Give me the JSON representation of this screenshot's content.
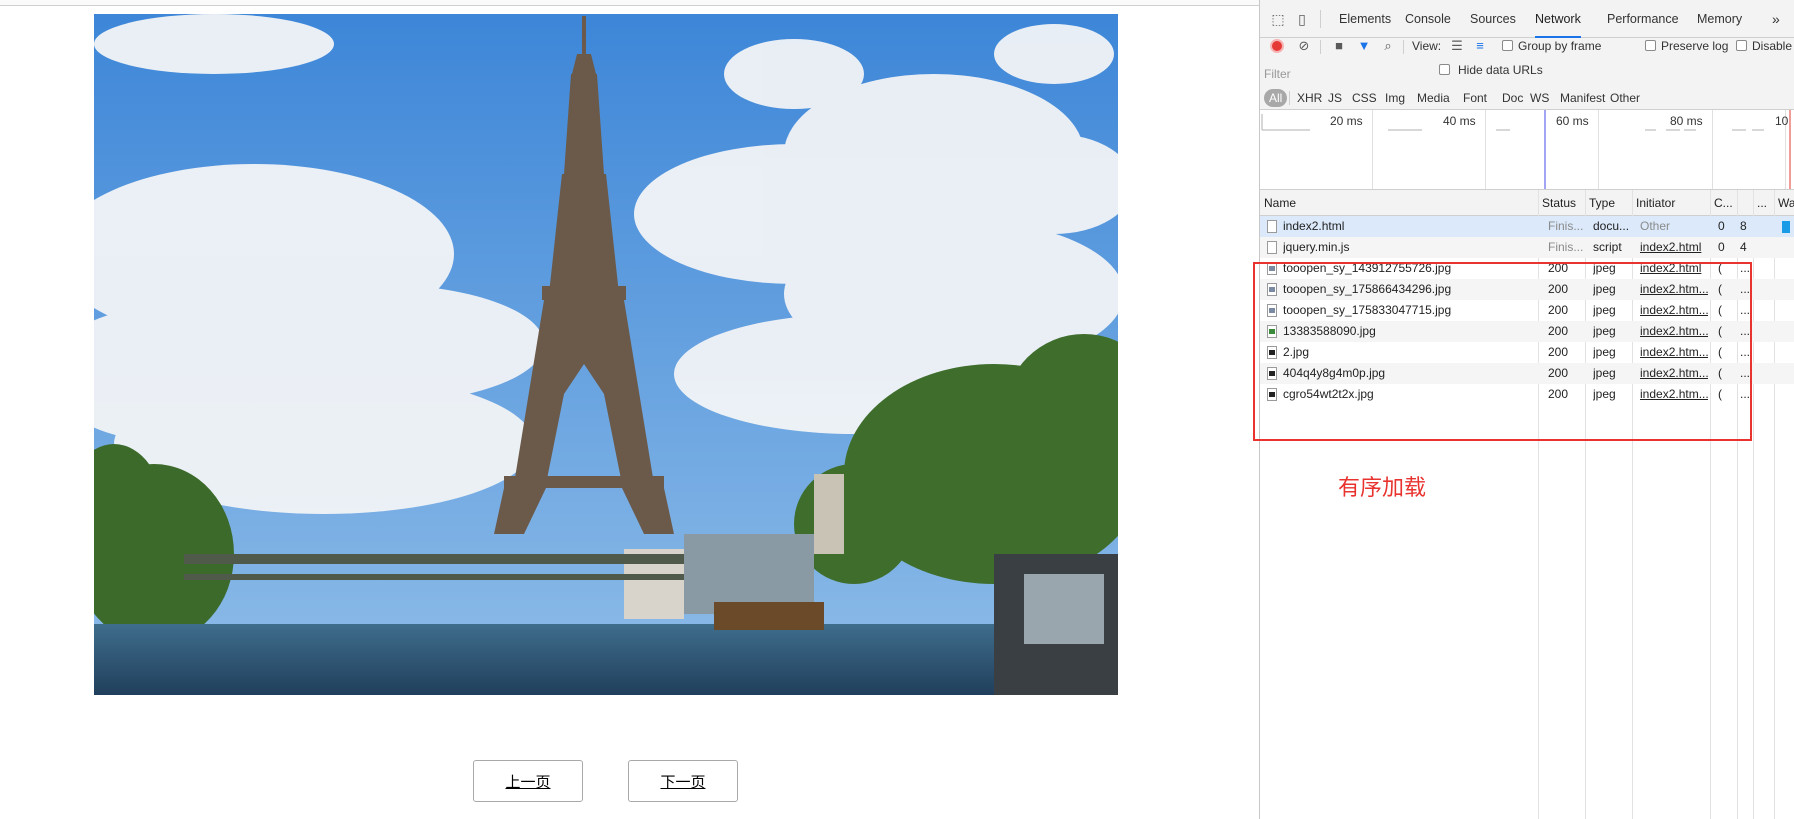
{
  "page": {
    "prev_label": "上一页",
    "next_label": "下一页"
  },
  "devtools": {
    "tabs": [
      {
        "label": "Elements",
        "active": false
      },
      {
        "label": "Console",
        "active": false
      },
      {
        "label": "Sources",
        "active": false
      },
      {
        "label": "Network",
        "active": true
      },
      {
        "label": "Performance",
        "active": false
      },
      {
        "label": "Memory",
        "active": false
      }
    ],
    "more_tabs": "»",
    "toolbar": {
      "view_label": "View:",
      "group_by_frame": "Group by frame",
      "preserve_log": "Preserve log",
      "disable_cache": "Disable"
    },
    "filter": {
      "placeholder": "Filter",
      "hide_data_urls": "Hide data URLs"
    },
    "types": [
      "All",
      "XHR",
      "JS",
      "CSS",
      "Img",
      "Media",
      "Font",
      "Doc",
      "WS",
      "Manifest",
      "Other"
    ],
    "active_type": "All",
    "timeline_ticks": [
      "20 ms",
      "40 ms",
      "60 ms",
      "80 ms",
      "10"
    ],
    "columns": [
      "Name",
      "Status",
      "Type",
      "Initiator",
      "C...",
      "...",
      "Wa"
    ],
    "requests": [
      {
        "name": "index2.html",
        "status": "Finis...",
        "type": "docu...",
        "initiator": "Other",
        "size": "0",
        "time": "8",
        "icon": "doc"
      },
      {
        "name": "jquery.min.js",
        "status": "Finis...",
        "type": "script",
        "initiator": "index2.html",
        "size": "0",
        "time": "4",
        "icon": "doc"
      },
      {
        "name": "tooopen_sy_143912755726.jpg",
        "status": "200",
        "type": "jpeg",
        "initiator": "index2.html",
        "size": "(",
        "time": "...",
        "icon": "img"
      },
      {
        "name": "tooopen_sy_175866434296.jpg",
        "status": "200",
        "type": "jpeg",
        "initiator": "index2.htm...",
        "size": "(",
        "time": "...",
        "icon": "img"
      },
      {
        "name": "tooopen_sy_175833047715.jpg",
        "status": "200",
        "type": "jpeg",
        "initiator": "index2.htm...",
        "size": "(",
        "time": "...",
        "icon": "img"
      },
      {
        "name": "13383588090.jpg",
        "status": "200",
        "type": "jpeg",
        "initiator": "index2.htm...",
        "size": "(",
        "time": "...",
        "icon": "img-green"
      },
      {
        "name": "2.jpg",
        "status": "200",
        "type": "jpeg",
        "initiator": "index2.htm...",
        "size": "(",
        "time": "...",
        "icon": "img-dark"
      },
      {
        "name": "404q4y8g4m0p.jpg",
        "status": "200",
        "type": "jpeg",
        "initiator": "index2.htm...",
        "size": "(",
        "time": "...",
        "icon": "img-dark"
      },
      {
        "name": "cgro54wt2t2x.jpg",
        "status": "200",
        "type": "jpeg",
        "initiator": "index2.htm...",
        "size": "(",
        "time": "...",
        "icon": "img-dark"
      }
    ]
  },
  "annotation": {
    "note": "有序加载",
    "color": "#e8332f"
  },
  "colors": {
    "accent": "#1a73e8",
    "record": "#e53935",
    "selected_row": "#dbe9fa",
    "waterfall": "#1a9be8"
  }
}
